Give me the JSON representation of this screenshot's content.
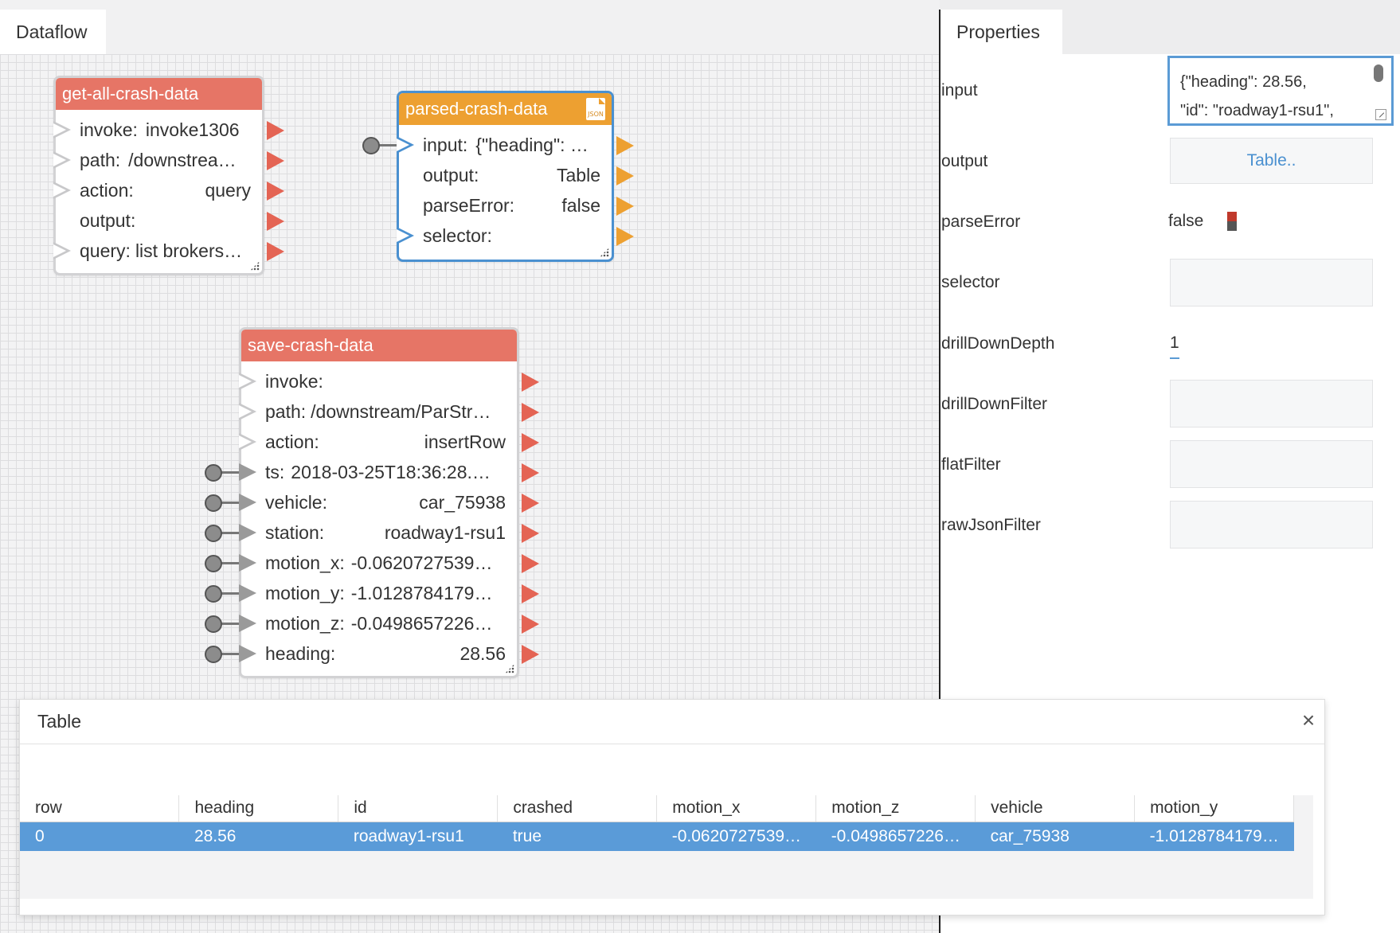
{
  "dataflow": {
    "tab_label": "Dataflow"
  },
  "nodes": {
    "get_all": {
      "title": "get-all-crash-data",
      "rows": [
        {
          "label": "invoke:",
          "value": "invoke1306"
        },
        {
          "label": "path:",
          "value": "/downstrea…"
        },
        {
          "label": "action:",
          "value": "query"
        },
        {
          "label": "output:",
          "value": ""
        },
        {
          "label": "query:",
          "value": "list brokers…"
        }
      ]
    },
    "parsed": {
      "title": "parsed-crash-data",
      "icon": "json-file-icon",
      "icon_text": "JSON",
      "rows": [
        {
          "label": "input:",
          "value": "{\"heading\": …"
        },
        {
          "label": "output:",
          "value": "Table"
        },
        {
          "label": "parseError:",
          "value": "false"
        },
        {
          "label": "selector:",
          "value": ""
        }
      ]
    },
    "save": {
      "title": "save-crash-data",
      "rows": [
        {
          "label": "invoke:",
          "value": ""
        },
        {
          "label": "path:",
          "value": "/downstream/ParStr…"
        },
        {
          "label": "action:",
          "value": "insertRow"
        },
        {
          "label": "ts:",
          "value": "2018-03-25T18:36:28.…"
        },
        {
          "label": "vehicle:",
          "value": "car_75938"
        },
        {
          "label": "station:",
          "value": "roadway1-rsu1"
        },
        {
          "label": "motion_x:",
          "value": "-0.0620727539…"
        },
        {
          "label": "motion_y:",
          "value": "-1.0128784179…"
        },
        {
          "label": "motion_z:",
          "value": "-0.0498657226…"
        },
        {
          "label": "heading:",
          "value": "28.56"
        }
      ]
    }
  },
  "properties": {
    "tab_label": "Properties",
    "input_label": "input",
    "input_value_line1": "{\"heading\": 28.56,",
    "input_value_line2": "\"id\": \"roadway1-rsu1\",",
    "output_label": "output",
    "output_button": "Table..",
    "parseError_label": "parseError",
    "parseError_value": "false",
    "selector_label": "selector",
    "drillDownDepth_label": "drillDownDepth",
    "drillDownDepth_value": "1",
    "drillDownFilter_label": "drillDownFilter",
    "flatFilter_label": "flatFilter",
    "rawJsonFilter_label": "rawJsonFilter"
  },
  "table_panel": {
    "title": "Table",
    "close_glyph": "×",
    "columns": [
      "row",
      "heading",
      "id",
      "crashed",
      "motion_x",
      "motion_z",
      "vehicle",
      "motion_y"
    ],
    "rows": [
      [
        "0",
        "28.56",
        "roadway1-rsu1",
        "true",
        "-0.0620727539…",
        "-0.0498657226…",
        "car_75938",
        "-1.0128784179…"
      ]
    ]
  }
}
